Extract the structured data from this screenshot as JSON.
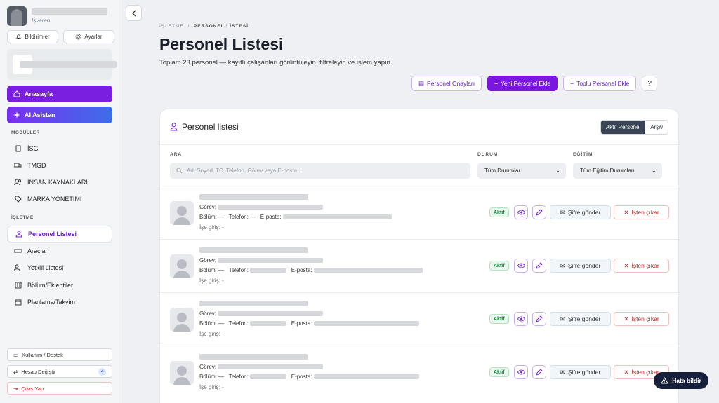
{
  "sidebar": {
    "role": "İşveren",
    "notifications_label": "Bildirimler",
    "settings_label": "Ayarlar",
    "home_label": "Anasayfa",
    "ai_label": "AI Asistan",
    "modules_heading": "MODÜLLER",
    "modules": [
      {
        "label": "İSG",
        "icon": "document-icon"
      },
      {
        "label": "TMGD",
        "icon": "truck-icon"
      },
      {
        "label": "İNSAN KAYNAKLARI",
        "icon": "people-icon"
      },
      {
        "label": "MARKA YÖNETİMİ",
        "icon": "tag-icon"
      }
    ],
    "business_heading": "İŞLETME",
    "business": [
      {
        "label": "Personel Listesi",
        "icon": "user-icon"
      },
      {
        "label": "Araçlar",
        "icon": "car-icon"
      },
      {
        "label": "Yetkili Listesi",
        "icon": "people-icon"
      },
      {
        "label": "Bölüm/Eklentiler",
        "icon": "building-icon"
      },
      {
        "label": "Planlama/Takvim",
        "icon": "calendar-icon"
      }
    ],
    "support_label": "Kullanım / Destek",
    "switch_label": "Hesap Değiştir",
    "switch_count": "4",
    "logout_label": "Çıkış Yap"
  },
  "breadcrumb": {
    "parent": "İŞLETME",
    "sep": "/",
    "current": "PERSONEL LİSTESİ"
  },
  "page": {
    "title": "Personel Listesi",
    "subtitle": "Toplam 23 personel — kayıtlı çalışanları görüntüleyin, filtreleyin ve işlem yapın."
  },
  "actions": {
    "approvals": "Personel Onayları",
    "add": "Yeni Personel Ekle",
    "bulk": "Toplu Personel Ekle",
    "help": "?"
  },
  "list": {
    "title": "Personel listesi",
    "tab_active": "Aktif Personel",
    "tab_archive": "Arşiv",
    "search_label": "ARA",
    "search_placeholder": "Ad, Soyad, TC, Telefon, Görev veya E-posta...",
    "status_label": "DURUM",
    "status_value": "Tüm Durumlar",
    "edu_label": "EĞİTİM",
    "edu_value": "Tüm Eğitim Durumları"
  },
  "rows": [
    {
      "gorev": "Görev:",
      "bolum": "Bölüm: —",
      "telefon": "Telefon: —",
      "eposta": "E-posta:",
      "giris": "İşe giriş: -",
      "status": "Aktif",
      "pw": "Şifre gönder",
      "remove": "İşten çıkar"
    },
    {
      "gorev": "Görev:",
      "bolum": "Bölüm: —",
      "telefon": "Telefon:",
      "eposta": "E-posta:",
      "giris": "İşe giriş: -",
      "status": "Aktif",
      "pw": "Şifre gönder",
      "remove": "İşten çıkar"
    },
    {
      "gorev": "Görev:",
      "bolum": "Bölüm: —",
      "telefon": "Telefon:",
      "eposta": "E-posta:",
      "giris": "İşe giriş: -",
      "status": "Aktif",
      "pw": "Şifre gönder",
      "remove": "İşten çıkar"
    },
    {
      "gorev": "Görev:",
      "bolum": "Bölüm: —",
      "telefon": "Telefon:",
      "eposta": "E-posta:",
      "giris": "İşe giriş: -",
      "status": "Aktif",
      "pw": "Şifre gönder",
      "remove": "İşten çıkar"
    }
  ],
  "report_label": "Hata bildir"
}
